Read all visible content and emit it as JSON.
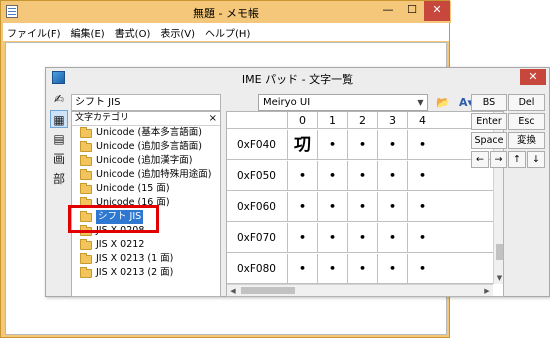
{
  "notepad": {
    "title": "無題 - メモ帳",
    "controls": {
      "minimize": "—",
      "maximize": "☐",
      "close": "✕"
    },
    "menu": [
      "ファイル(F)",
      "編集(E)",
      "書式(O)",
      "表示(V)",
      "ヘルプ(H)"
    ]
  },
  "ime": {
    "title": "IME パッド - 文字一覧",
    "close": "✕",
    "tools": [
      "✍",
      "▦",
      "▤",
      "画",
      "部"
    ],
    "category_current": "シフト JIS",
    "category_panel_header": "文字カテゴリ",
    "category_panel_close": "×",
    "categories": [
      "Unicode (基本多言語面)",
      "Unicode (追加多言語面)",
      "Unicode (追加漢字面)",
      "Unicode (追加特殊用途面)",
      "Unicode (15 面)",
      "Unicode (16 面)",
      "シフト JIS",
      "JIS X 0208",
      "JIS X 0212",
      "JIS X 0213 (1 面)",
      "JIS X 0213 (2 面)"
    ],
    "selected_category": "シフト JIS",
    "font": "Meiryo UI",
    "font_dropdown": "▼",
    "toolbar_icons": {
      "open": "📂",
      "font": "A▾",
      "view": "⊞▾"
    },
    "grid": {
      "columns": [
        "0",
        "1",
        "2",
        "3",
        "4"
      ],
      "rows": [
        {
          "label": "0xF040",
          "cells": [
            "㓛",
            "•",
            "•",
            "•",
            "•"
          ]
        },
        {
          "label": "0xF050",
          "cells": [
            "•",
            "•",
            "•",
            "•",
            "•"
          ]
        },
        {
          "label": "0xF060",
          "cells": [
            "•",
            "•",
            "•",
            "•",
            "•"
          ]
        },
        {
          "label": "0xF070",
          "cells": [
            "•",
            "•",
            "•",
            "•",
            "•"
          ]
        },
        {
          "label": "0xF080",
          "cells": [
            "•",
            "•",
            "•",
            "•",
            "•"
          ]
        }
      ]
    },
    "keys": {
      "bs": "BS",
      "del": "Del",
      "enter": "Enter",
      "esc": "Esc",
      "space": "Space",
      "convert": "変換",
      "left": "←",
      "right": "→",
      "up": "↑",
      "down": "↓"
    },
    "scroll_arrows": {
      "up": "▲",
      "down": "▼",
      "left": "◀",
      "right": "▶"
    }
  },
  "colors": {
    "notepad_frame": "#f4c77a",
    "close_button": "#c7473c",
    "highlight_box": "#e10000",
    "selection": "#2f78d1"
  }
}
